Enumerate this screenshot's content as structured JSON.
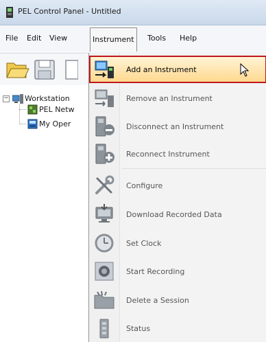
{
  "window": {
    "title": "PEL Control Panel - Untitled"
  },
  "menubar": {
    "items": [
      "File",
      "Edit",
      "View",
      "Instrument",
      "Tools",
      "Help"
    ],
    "active": "Instrument"
  },
  "tree": {
    "root_label": "Workstation",
    "children": [
      "PEL Netw",
      "My Oper"
    ]
  },
  "instrument_menu": {
    "items": [
      {
        "label": "Add an Instrument",
        "highlighted": true
      },
      {
        "label": "Remove an Instrument"
      },
      {
        "label": "Disconnect an Instrument"
      },
      {
        "label": "Reconnect Instrument"
      },
      {
        "label": "Configure"
      },
      {
        "label": "Download Recorded Data"
      },
      {
        "label": "Set Clock"
      },
      {
        "label": "Start Recording"
      },
      {
        "label": "Delete a Session"
      },
      {
        "label": "Status"
      }
    ]
  },
  "colors": {
    "highlight_border": "#c0161d",
    "highlight_fill": "#ffd88f",
    "menu_background": "#f3f3f3"
  }
}
